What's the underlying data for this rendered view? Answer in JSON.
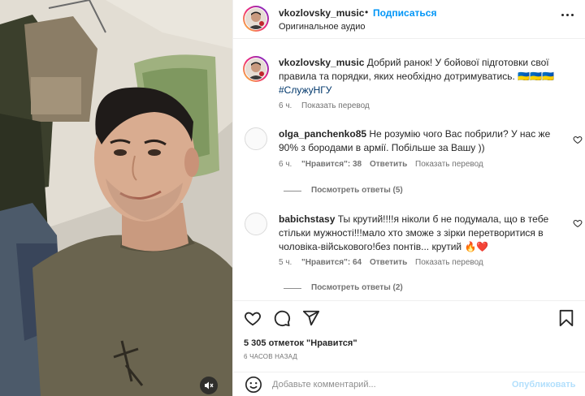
{
  "header": {
    "username": "vkozlovsky_music",
    "separator": "•",
    "follow_label": "Подписаться",
    "audio_label": "Оригинальное аудио"
  },
  "caption": {
    "username": "vkozlovsky_music",
    "text": "Добрий ранок! У бойової підготовки свої правила та порядки, яких необхідно дотримуватись.",
    "emojis": "🇺🇦🇺🇦🇺🇦",
    "hashtag": "#СлужуНГУ",
    "time": "6 ч.",
    "translate_label": "Показать перевод"
  },
  "comments": [
    {
      "username": "olga_panchenko85",
      "text": "Не розумію чого Вас побрили? У нас же 90% з бородами в армії. Побільше за Вашу ))",
      "time": "6 ч.",
      "likes_label": "\"Нравится\": 38",
      "reply_label": "Ответить",
      "translate_label": "Показать перевод",
      "view_replies": "Посмотреть ответы (5)"
    },
    {
      "username": "babichstasy",
      "text": "Ты крутий!!!!я ніколи б не подумала, що в тебе стільки мужності!!!мало хто зможе з зірки перетворитися в чоловіка-військового!без понтів... крутий",
      "emojis": "🔥❤️",
      "time": "5 ч.",
      "likes_label": "\"Нравится\": 64",
      "reply_label": "Ответить",
      "translate_label": "Показать перевод",
      "view_replies": "Посмотреть ответы (2)"
    }
  ],
  "icons": {
    "like": "heart-icon",
    "comment": "comment-icon",
    "share": "share-icon",
    "save": "bookmark-icon",
    "emoji": "emoji-icon",
    "mute": "mute-icon",
    "more": "more-options-icon"
  },
  "likes_count": "5 305 отметок \"Нравится\"",
  "post_time": "6 ЧАСОВ НАЗАД",
  "comment_box": {
    "placeholder": "Добавьте комментарий...",
    "value": "",
    "publish_label": "Опубликовать"
  },
  "colors": {
    "link_blue": "#0095f6",
    "hashtag": "#00376b",
    "publish_disabled": "#b2dffc",
    "muted_text": "#737373"
  }
}
